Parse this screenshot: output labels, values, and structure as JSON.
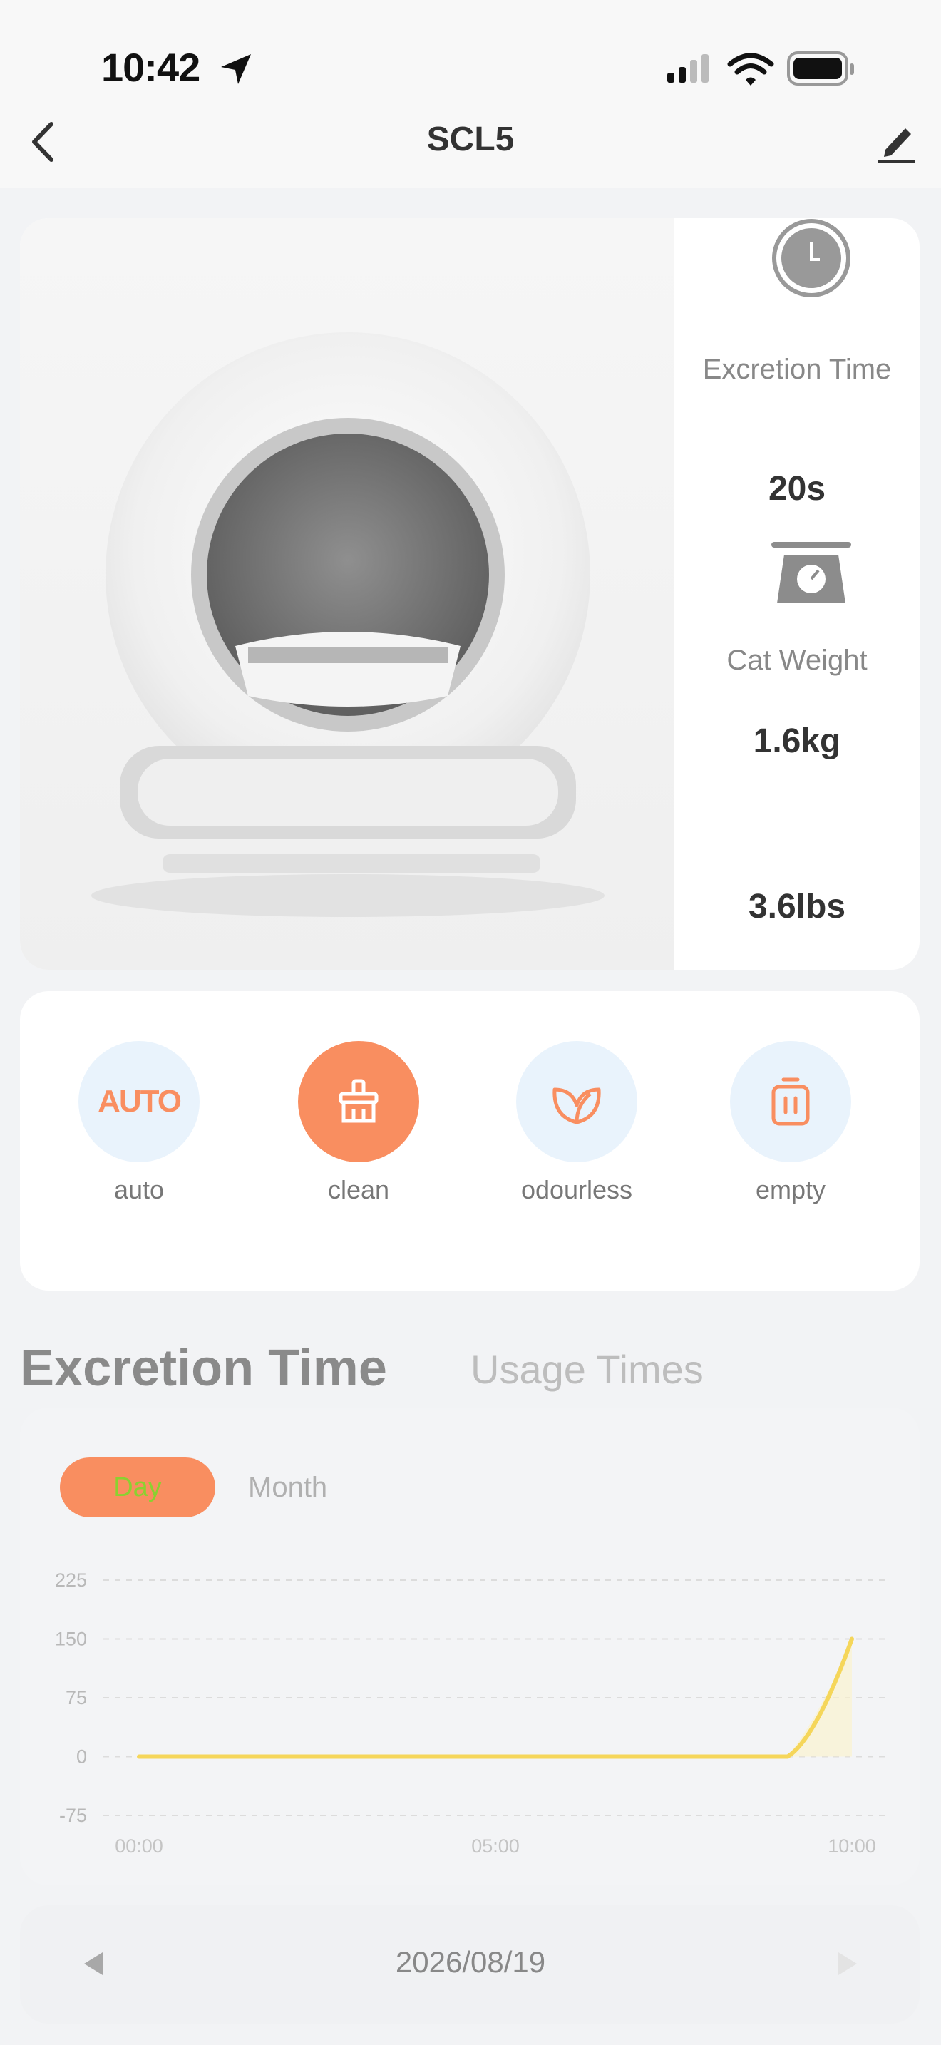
{
  "status": {
    "time": "10:42"
  },
  "nav": {
    "title": "SCL5"
  },
  "stats": {
    "excretion_label": "Excretion Time",
    "excretion_value": "20s",
    "weight_label": "Cat Weight",
    "weight_kg": "1.6kg",
    "weight_lbs": "3.6lbs"
  },
  "actions": [
    {
      "label": "auto",
      "icon": "auto-icon",
      "active": false
    },
    {
      "label": "clean",
      "icon": "broom-icon",
      "active": true
    },
    {
      "label": "odourless",
      "icon": "leaf-icon",
      "active": false
    },
    {
      "label": "empty",
      "icon": "trash-icon",
      "active": false
    }
  ],
  "action_icon_text": "AUTO",
  "section_tabs": {
    "active": "Excretion Time",
    "inactive": "Usage Times"
  },
  "period": {
    "day": "Day",
    "month": "Month"
  },
  "chart_data": {
    "type": "line",
    "x_ticks": [
      "00:00",
      "05:00",
      "10:00"
    ],
    "y_ticks": [
      225,
      150,
      75,
      0,
      -75
    ],
    "ylim": [
      -75,
      225
    ],
    "series": [
      {
        "color": "#f5d65a",
        "points": [
          [
            0,
            0
          ],
          [
            9.1,
            0
          ],
          [
            9.6,
            60
          ],
          [
            10.0,
            150
          ]
        ]
      }
    ],
    "grid": true
  },
  "date_nav": {
    "date": "2026/08/19"
  },
  "colors": {
    "accent": "#f98e60",
    "icon_bg": "#e9f3fc",
    "line": "#f5d65a"
  }
}
